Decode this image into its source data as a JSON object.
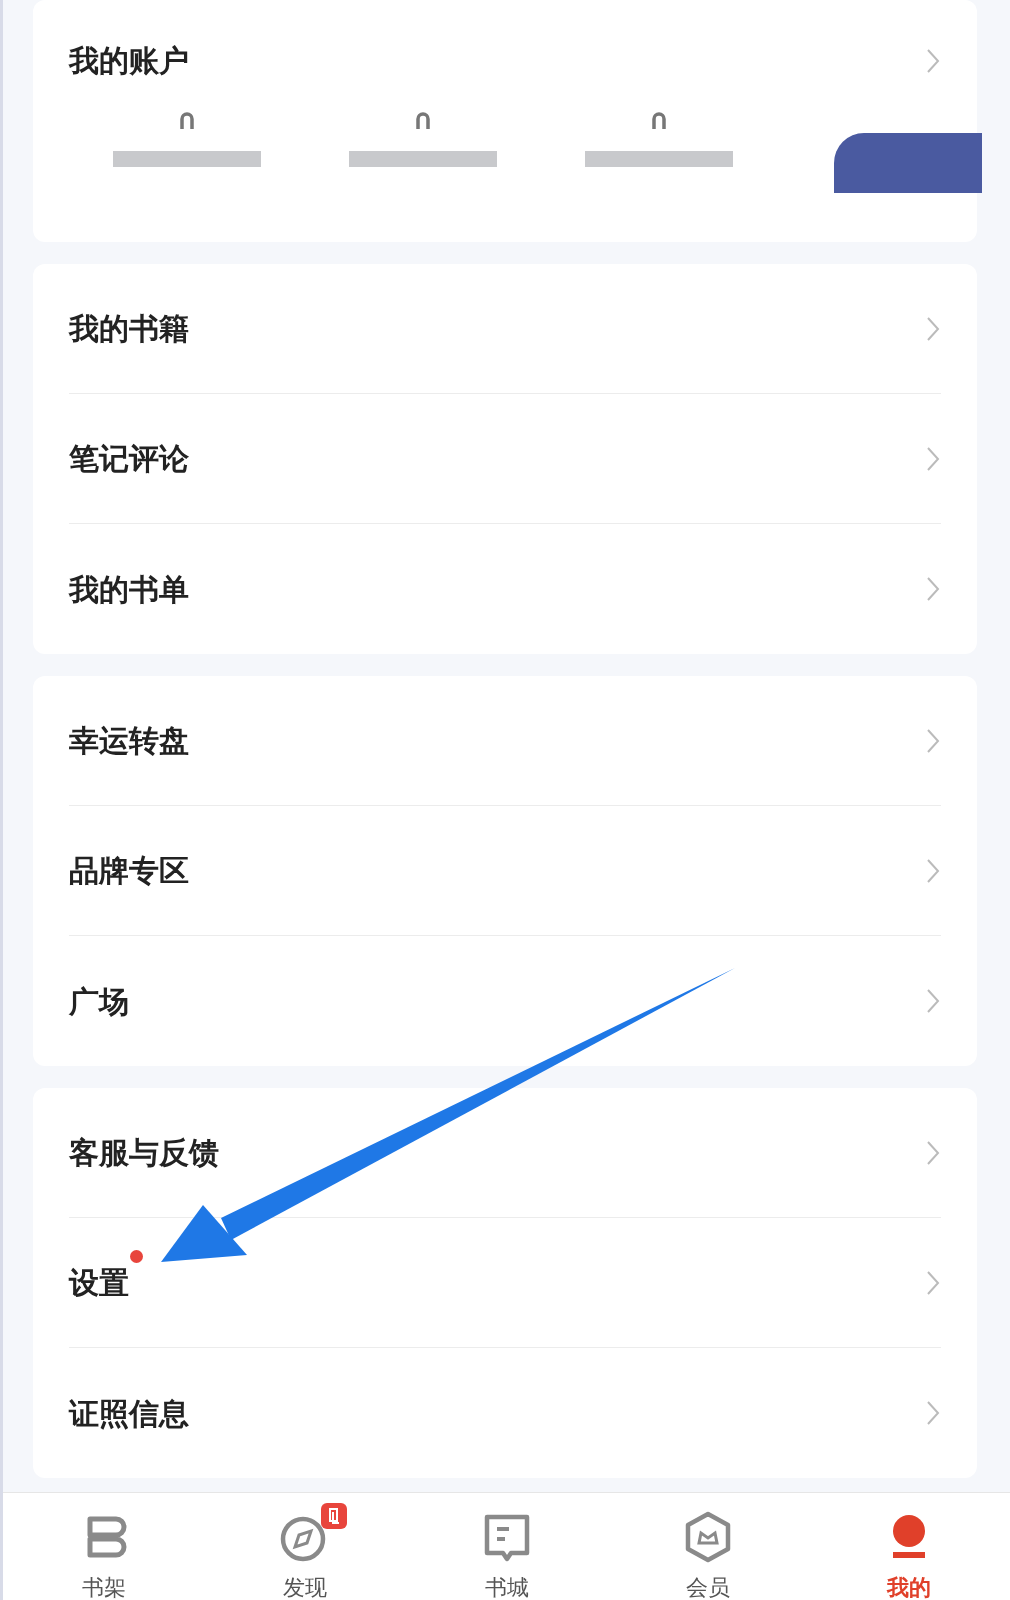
{
  "account": {
    "title": "我的账户"
  },
  "groups": [
    {
      "items": [
        {
          "label": "我的书籍",
          "dot": false
        },
        {
          "label": "笔记评论",
          "dot": false
        },
        {
          "label": "我的书单",
          "dot": false
        }
      ]
    },
    {
      "items": [
        {
          "label": "幸运转盘",
          "dot": false
        },
        {
          "label": "品牌专区",
          "dot": false
        },
        {
          "label": "广场",
          "dot": false
        }
      ]
    },
    {
      "items": [
        {
          "label": "客服与反馈",
          "dot": false
        },
        {
          "label": "设置",
          "dot": true
        },
        {
          "label": "证照信息",
          "dot": false
        }
      ]
    }
  ],
  "tabbar": [
    {
      "label": "书架",
      "kind": "shelf",
      "selected": false,
      "badge": false
    },
    {
      "label": "发现",
      "kind": "compass",
      "selected": false,
      "badge": true
    },
    {
      "label": "书城",
      "kind": "book",
      "selected": false,
      "badge": false
    },
    {
      "label": "会员",
      "kind": "hexagon",
      "selected": false,
      "badge": false
    },
    {
      "label": "我的",
      "kind": "profile",
      "selected": true,
      "badge": false
    }
  ]
}
